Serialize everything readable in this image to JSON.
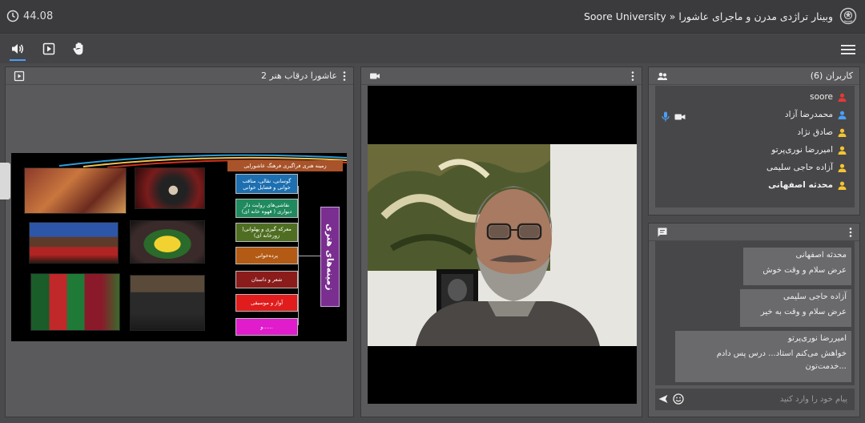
{
  "header": {
    "timer": "44.08",
    "breadcrumb": "Soore University » وبینار تراژدی مدرن و ماجرای عاشورا",
    "logo_icon": "university-seal-icon"
  },
  "toolbar": {
    "icons": [
      "speaker-icon",
      "presentation-play-icon",
      "raise-hand-icon",
      "menu-icon"
    ],
    "accent": "#4a9ff5"
  },
  "presentation": {
    "title": "عاشورا درقاب هنر 2",
    "slide": {
      "header": "زمینه هنری فراگیری فرهنگ عاشورایی",
      "vertical_label": "زمینه‌های هنری",
      "boxes": [
        {
          "text": "گوسانی، نقالی، مناقب خوانی و فضایل خوانی",
          "color": "#1d6fb0"
        },
        {
          "text": "نقاشی‌های روایت دار دیواری ( قهوه خانه ای)",
          "color": "#1f8a5e"
        },
        {
          "text": "معرکه گیری و پهلوانی( زورخانه ای)",
          "color": "#4f6e22"
        },
        {
          "text": "پرده‌خوانی",
          "color": "#b35a14"
        },
        {
          "text": "شعر و داستان",
          "color": "#8a1c1c"
        },
        {
          "text": "آواز و موسیقی",
          "color": "#e01c1c"
        },
        {
          "text": "و......",
          "color": "#e01ccc"
        }
      ]
    }
  },
  "video": {
    "camera_icon": "video-camera-icon"
  },
  "users": {
    "title": "کاربران (6)",
    "items": [
      {
        "name": "soore",
        "color": "#e53935",
        "bold": false
      },
      {
        "name": "محمدرضا آزاد",
        "color": "#4a9ff5",
        "bold": false
      },
      {
        "name": "صادق نژاد",
        "color": "#f4c430",
        "bold": false
      },
      {
        "name": "امیررضا نوری‌پرتو",
        "color": "#f4c430",
        "bold": false
      },
      {
        "name": "آزاده حاجی سلیمی",
        "color": "#f4c430",
        "bold": false
      },
      {
        "name": "محدثه اصفهانی",
        "color": "#f4c430",
        "bold": true
      }
    ]
  },
  "chat": {
    "messages": [
      {
        "name": "محدثه اصفهانی",
        "text": "عرض سلام و وقت خوش"
      },
      {
        "name": "آزاده حاجی سلیمی",
        "text": "عرض سلام و وقت به خیر"
      },
      {
        "name": "امیررضا نوری‌پرتو",
        "text": "خواهش می‌کنم استاد... درس پس دادم",
        "text2": "خدمت‌تون..."
      }
    ],
    "placeholder": "پیام خود را وارد کنید"
  }
}
